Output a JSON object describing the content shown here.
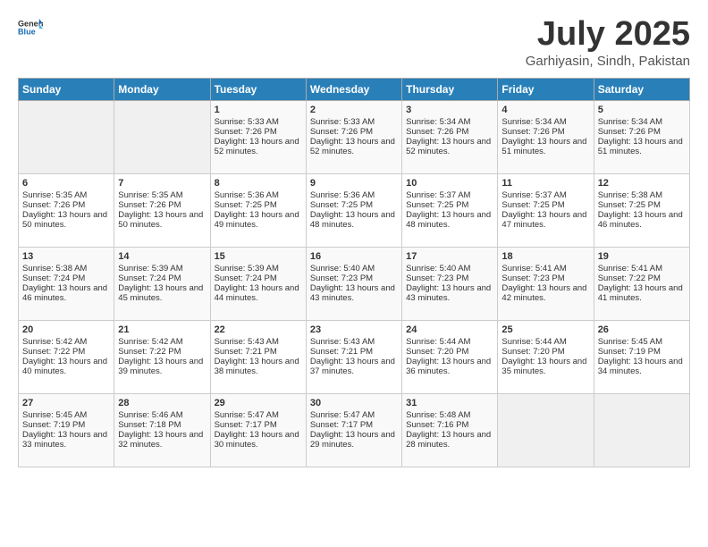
{
  "header": {
    "logo_general": "General",
    "logo_blue": "Blue",
    "month": "July 2025",
    "location": "Garhiyasin, Sindh, Pakistan"
  },
  "days_of_week": [
    "Sunday",
    "Monday",
    "Tuesday",
    "Wednesday",
    "Thursday",
    "Friday",
    "Saturday"
  ],
  "weeks": [
    [
      {
        "num": "",
        "sunrise": "",
        "sunset": "",
        "daylight": "",
        "empty": true
      },
      {
        "num": "",
        "sunrise": "",
        "sunset": "",
        "daylight": "",
        "empty": true
      },
      {
        "num": "1",
        "sunrise": "Sunrise: 5:33 AM",
        "sunset": "Sunset: 7:26 PM",
        "daylight": "Daylight: 13 hours and 52 minutes.",
        "empty": false
      },
      {
        "num": "2",
        "sunrise": "Sunrise: 5:33 AM",
        "sunset": "Sunset: 7:26 PM",
        "daylight": "Daylight: 13 hours and 52 minutes.",
        "empty": false
      },
      {
        "num": "3",
        "sunrise": "Sunrise: 5:34 AM",
        "sunset": "Sunset: 7:26 PM",
        "daylight": "Daylight: 13 hours and 52 minutes.",
        "empty": false
      },
      {
        "num": "4",
        "sunrise": "Sunrise: 5:34 AM",
        "sunset": "Sunset: 7:26 PM",
        "daylight": "Daylight: 13 hours and 51 minutes.",
        "empty": false
      },
      {
        "num": "5",
        "sunrise": "Sunrise: 5:34 AM",
        "sunset": "Sunset: 7:26 PM",
        "daylight": "Daylight: 13 hours and 51 minutes.",
        "empty": false
      }
    ],
    [
      {
        "num": "6",
        "sunrise": "Sunrise: 5:35 AM",
        "sunset": "Sunset: 7:26 PM",
        "daylight": "Daylight: 13 hours and 50 minutes.",
        "empty": false
      },
      {
        "num": "7",
        "sunrise": "Sunrise: 5:35 AM",
        "sunset": "Sunset: 7:26 PM",
        "daylight": "Daylight: 13 hours and 50 minutes.",
        "empty": false
      },
      {
        "num": "8",
        "sunrise": "Sunrise: 5:36 AM",
        "sunset": "Sunset: 7:25 PM",
        "daylight": "Daylight: 13 hours and 49 minutes.",
        "empty": false
      },
      {
        "num": "9",
        "sunrise": "Sunrise: 5:36 AM",
        "sunset": "Sunset: 7:25 PM",
        "daylight": "Daylight: 13 hours and 48 minutes.",
        "empty": false
      },
      {
        "num": "10",
        "sunrise": "Sunrise: 5:37 AM",
        "sunset": "Sunset: 7:25 PM",
        "daylight": "Daylight: 13 hours and 48 minutes.",
        "empty": false
      },
      {
        "num": "11",
        "sunrise": "Sunrise: 5:37 AM",
        "sunset": "Sunset: 7:25 PM",
        "daylight": "Daylight: 13 hours and 47 minutes.",
        "empty": false
      },
      {
        "num": "12",
        "sunrise": "Sunrise: 5:38 AM",
        "sunset": "Sunset: 7:25 PM",
        "daylight": "Daylight: 13 hours and 46 minutes.",
        "empty": false
      }
    ],
    [
      {
        "num": "13",
        "sunrise": "Sunrise: 5:38 AM",
        "sunset": "Sunset: 7:24 PM",
        "daylight": "Daylight: 13 hours and 46 minutes.",
        "empty": false
      },
      {
        "num": "14",
        "sunrise": "Sunrise: 5:39 AM",
        "sunset": "Sunset: 7:24 PM",
        "daylight": "Daylight: 13 hours and 45 minutes.",
        "empty": false
      },
      {
        "num": "15",
        "sunrise": "Sunrise: 5:39 AM",
        "sunset": "Sunset: 7:24 PM",
        "daylight": "Daylight: 13 hours and 44 minutes.",
        "empty": false
      },
      {
        "num": "16",
        "sunrise": "Sunrise: 5:40 AM",
        "sunset": "Sunset: 7:23 PM",
        "daylight": "Daylight: 13 hours and 43 minutes.",
        "empty": false
      },
      {
        "num": "17",
        "sunrise": "Sunrise: 5:40 AM",
        "sunset": "Sunset: 7:23 PM",
        "daylight": "Daylight: 13 hours and 43 minutes.",
        "empty": false
      },
      {
        "num": "18",
        "sunrise": "Sunrise: 5:41 AM",
        "sunset": "Sunset: 7:23 PM",
        "daylight": "Daylight: 13 hours and 42 minutes.",
        "empty": false
      },
      {
        "num": "19",
        "sunrise": "Sunrise: 5:41 AM",
        "sunset": "Sunset: 7:22 PM",
        "daylight": "Daylight: 13 hours and 41 minutes.",
        "empty": false
      }
    ],
    [
      {
        "num": "20",
        "sunrise": "Sunrise: 5:42 AM",
        "sunset": "Sunset: 7:22 PM",
        "daylight": "Daylight: 13 hours and 40 minutes.",
        "empty": false
      },
      {
        "num": "21",
        "sunrise": "Sunrise: 5:42 AM",
        "sunset": "Sunset: 7:22 PM",
        "daylight": "Daylight: 13 hours and 39 minutes.",
        "empty": false
      },
      {
        "num": "22",
        "sunrise": "Sunrise: 5:43 AM",
        "sunset": "Sunset: 7:21 PM",
        "daylight": "Daylight: 13 hours and 38 minutes.",
        "empty": false
      },
      {
        "num": "23",
        "sunrise": "Sunrise: 5:43 AM",
        "sunset": "Sunset: 7:21 PM",
        "daylight": "Daylight: 13 hours and 37 minutes.",
        "empty": false
      },
      {
        "num": "24",
        "sunrise": "Sunrise: 5:44 AM",
        "sunset": "Sunset: 7:20 PM",
        "daylight": "Daylight: 13 hours and 36 minutes.",
        "empty": false
      },
      {
        "num": "25",
        "sunrise": "Sunrise: 5:44 AM",
        "sunset": "Sunset: 7:20 PM",
        "daylight": "Daylight: 13 hours and 35 minutes.",
        "empty": false
      },
      {
        "num": "26",
        "sunrise": "Sunrise: 5:45 AM",
        "sunset": "Sunset: 7:19 PM",
        "daylight": "Daylight: 13 hours and 34 minutes.",
        "empty": false
      }
    ],
    [
      {
        "num": "27",
        "sunrise": "Sunrise: 5:45 AM",
        "sunset": "Sunset: 7:19 PM",
        "daylight": "Daylight: 13 hours and 33 minutes.",
        "empty": false
      },
      {
        "num": "28",
        "sunrise": "Sunrise: 5:46 AM",
        "sunset": "Sunset: 7:18 PM",
        "daylight": "Daylight: 13 hours and 32 minutes.",
        "empty": false
      },
      {
        "num": "29",
        "sunrise": "Sunrise: 5:47 AM",
        "sunset": "Sunset: 7:17 PM",
        "daylight": "Daylight: 13 hours and 30 minutes.",
        "empty": false
      },
      {
        "num": "30",
        "sunrise": "Sunrise: 5:47 AM",
        "sunset": "Sunset: 7:17 PM",
        "daylight": "Daylight: 13 hours and 29 minutes.",
        "empty": false
      },
      {
        "num": "31",
        "sunrise": "Sunrise: 5:48 AM",
        "sunset": "Sunset: 7:16 PM",
        "daylight": "Daylight: 13 hours and 28 minutes.",
        "empty": false
      },
      {
        "num": "",
        "sunrise": "",
        "sunset": "",
        "daylight": "",
        "empty": true
      },
      {
        "num": "",
        "sunrise": "",
        "sunset": "",
        "daylight": "",
        "empty": true
      }
    ]
  ]
}
